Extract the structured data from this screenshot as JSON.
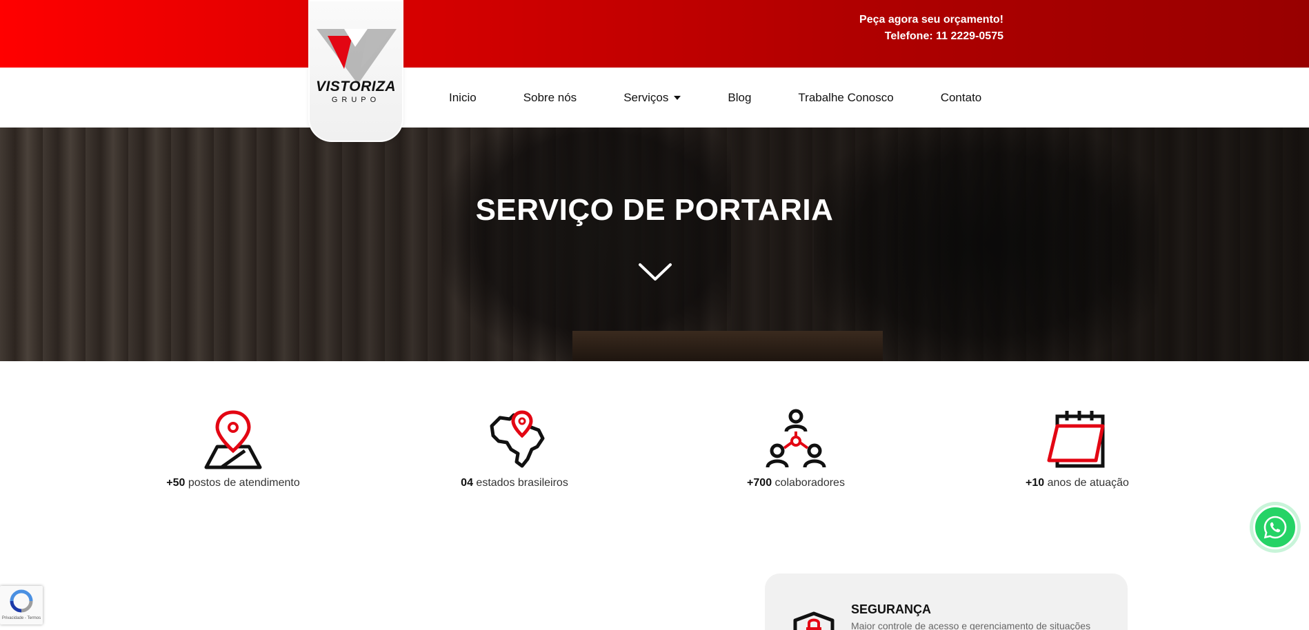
{
  "topbar": {
    "cta_line1": "Peça agora seu orçamento!",
    "cta_line2": "Telefone: 11 2229-0575"
  },
  "logo": {
    "word": "VISTORIZA",
    "sub": "GRUPO"
  },
  "nav": {
    "items": [
      {
        "label": "Inicio"
      },
      {
        "label": "Sobre nós"
      },
      {
        "label": "Serviços",
        "has_dropdown": true
      },
      {
        "label": "Blog"
      },
      {
        "label": "Trabalhe Conosco"
      },
      {
        "label": "Contato"
      }
    ]
  },
  "hero": {
    "title": "SERVIÇO DE PORTARIA",
    "scroll_icon": "chevron-down-icon"
  },
  "stats": [
    {
      "bold": "+50",
      "text": " postos de atendimento",
      "icon": "map-pin-icon"
    },
    {
      "bold": "04",
      "text": " estados brasileiros",
      "icon": "brazil-map-icon"
    },
    {
      "bold": "+700",
      "text": " colaboradores",
      "icon": "people-network-icon"
    },
    {
      "bold": "+10",
      "text": " anos de atuação",
      "icon": "calendar-icon"
    }
  ],
  "feature": {
    "title": "SEGURANÇA",
    "description": "Maior controle de acesso e gerenciamento de situações",
    "icon": "shield-lock-icon"
  },
  "recaptcha": {
    "terms": "Privacidade - Termos"
  },
  "colors": {
    "brand_red": "#e30613",
    "topbar_dark": "#980000",
    "whatsapp_green": "#25d366"
  }
}
